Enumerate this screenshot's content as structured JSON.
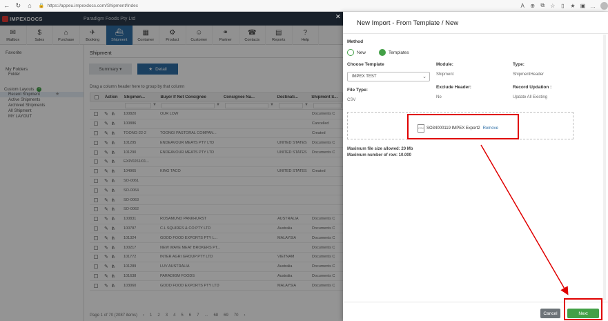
{
  "browser": {
    "url": "https://appeu.impexdocs.com/Shipment/Index"
  },
  "app": {
    "logo_text": "IMPEXDOCS",
    "company": "Paradigm Foods Pty Ltd"
  },
  "toolbar": [
    {
      "label": "Mailbox",
      "icon": "mailbox-icon",
      "glyph": "✉"
    },
    {
      "label": "Sales",
      "icon": "sales-icon",
      "glyph": "$"
    },
    {
      "label": "Purchase",
      "icon": "purchase-icon",
      "glyph": "⌂"
    },
    {
      "label": "Booking",
      "icon": "booking-icon",
      "glyph": "✈"
    },
    {
      "label": "Shipment",
      "icon": "ship-icon",
      "glyph": "⛴",
      "active": true
    },
    {
      "label": "Container",
      "icon": "container-icon",
      "glyph": "▦"
    },
    {
      "label": "Product",
      "icon": "product-icon",
      "glyph": "⚙"
    },
    {
      "label": "Customer",
      "icon": "customer-icon",
      "glyph": "☺"
    },
    {
      "label": "Partner",
      "icon": "handshake-icon",
      "glyph": "⚭"
    },
    {
      "label": "Contacts",
      "icon": "phone-icon",
      "glyph": "☎"
    },
    {
      "label": "Reports",
      "icon": "report-icon",
      "glyph": "▤"
    },
    {
      "label": "Help",
      "icon": "help-icon",
      "glyph": "?"
    }
  ],
  "sidebar": {
    "favorite": "Favorite",
    "my_folders": "My Folders",
    "folder": "Folder",
    "custom_layouts": "Custom Layouts",
    "layouts": [
      "Recent Shipment",
      "Active Shipments",
      "Archived Shipments",
      "All Shipment",
      "MY LAYOUT"
    ]
  },
  "main": {
    "title": "Shipment",
    "tab_summary": "Summary ▾",
    "tab_detail": "Detail",
    "drag_hint": "Drag a column header here to group by that column",
    "columns": [
      "Action",
      "Shipmen...",
      "Buyer If Not Consignee",
      "Consignee Na...",
      "Destinati...",
      "Shipment S..."
    ],
    "rows": [
      [
        "100820",
        "OUR LOW",
        "",
        "",
        "Documents C"
      ],
      [
        "100886",
        "",
        "",
        "",
        "Cancelled"
      ],
      [
        "TOONG-22-2",
        "TOONGI PASTORAL COMPAN...",
        "",
        "",
        "Created"
      ],
      [
        "101295",
        "ENDEAVOUR MEATS PTY LTD",
        "",
        "UNITED STATES",
        "Documents C"
      ],
      [
        "101290",
        "ENDEAVOUR MEATS PTY LTD",
        "",
        "UNITED STATES",
        "Documents C"
      ],
      [
        "EXP/0261/01...",
        "",
        "",
        "",
        ""
      ],
      [
        "104965",
        "KING TACO",
        "",
        "UNITED STATES",
        "Created"
      ],
      [
        "SO-0061",
        "",
        "",
        "",
        ""
      ],
      [
        "SO-0064",
        "",
        "",
        "",
        ""
      ],
      [
        "SO-0063",
        "",
        "",
        "",
        ""
      ],
      [
        "SO-0062",
        "",
        "",
        "",
        ""
      ],
      [
        "100831",
        "ROSAMUND PANKHURST",
        "",
        "AUSTRALIA",
        "Documents C"
      ],
      [
        "100787",
        "C.L SQUIRES & CO PTY LTD",
        "",
        "Australia",
        "Documents C"
      ],
      [
        "101324",
        "GOOD FOOD EXPORTS PTY L...",
        "",
        "MALAYSIA",
        "Documents C"
      ],
      [
        "100217",
        "NEW WAVE MEAT BROKERS PT...",
        "",
        "",
        "Documents C"
      ],
      [
        "101772",
        "INTER AGRI GROUP PTY LTD",
        "",
        "VIETNAM",
        "Documents C"
      ],
      [
        "101289",
        "LUV AUSTRALIA",
        "",
        "Australia",
        "Documents C"
      ],
      [
        "101638",
        "PARADIGM FOODS",
        "",
        "Australia",
        "Documents C"
      ],
      [
        "103060",
        "GOOD FOOD EXPORTS PTY LTD",
        "",
        "MALAYSIA",
        "Documents C"
      ]
    ],
    "pager": [
      "Page 1 of 70 (2087 items)",
      "‹",
      "1",
      "2",
      "3",
      "4",
      "5",
      "6",
      "7",
      "...",
      "68",
      "69",
      "70",
      "›"
    ]
  },
  "panel": {
    "title": "New Import - From Template / New",
    "method_label": "Method",
    "method_new": "New",
    "method_templates": "Templates",
    "choose_template_label": "Choose Template",
    "choose_template_value": "IMPEX TEST",
    "module_label": "Module:",
    "module_value": "Shipment",
    "type_label": "Type:",
    "type_value": "ShipmentHeader",
    "file_type_label": "File Type:",
    "file_type_value": "CSV",
    "exclude_header_label": "Exclude Header:",
    "exclude_header_value": "No",
    "record_updation_label": "Record Updation :",
    "record_updation_value": "Update All Existing",
    "file_name": "SO34000119 IMPEX Export2",
    "file_remove": "Remove",
    "max_size": "Maximum file size allowed: 20 Mb",
    "max_rows": "Maximum number of row: 10.000",
    "cancel": "Cancel",
    "next": "Next"
  },
  "colors": {
    "accent_blue": "#2f6fa6",
    "green": "#43a047",
    "annotation_red": "#e00000"
  }
}
